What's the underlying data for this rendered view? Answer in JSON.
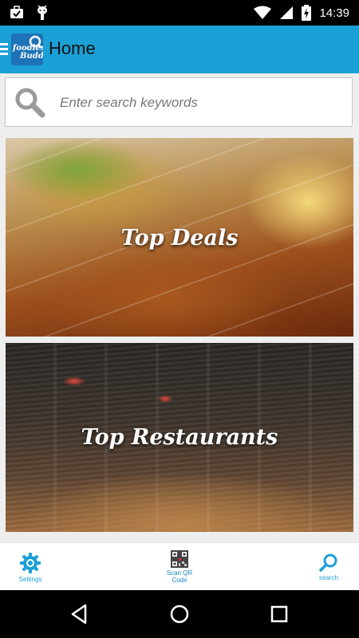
{
  "status_bar": {
    "time": "14:39"
  },
  "app_bar": {
    "title": "Home",
    "logo_text_line1": "foodies",
    "logo_text_line2": "Buddy"
  },
  "search": {
    "placeholder": "Enter search keywords"
  },
  "cards": [
    {
      "label": "Top Deals"
    },
    {
      "label": "Top Restaurants"
    }
  ],
  "tabs": [
    {
      "label": "Settings",
      "icon": "gear-icon"
    },
    {
      "label_line1": "Scan QR",
      "label_line2": "Code",
      "icon": "qr-code-icon"
    },
    {
      "label": "search",
      "icon": "search-icon"
    }
  ],
  "colors": {
    "accent": "#1ba0d6",
    "status_bar": "#000000",
    "background": "#eeeeee"
  }
}
